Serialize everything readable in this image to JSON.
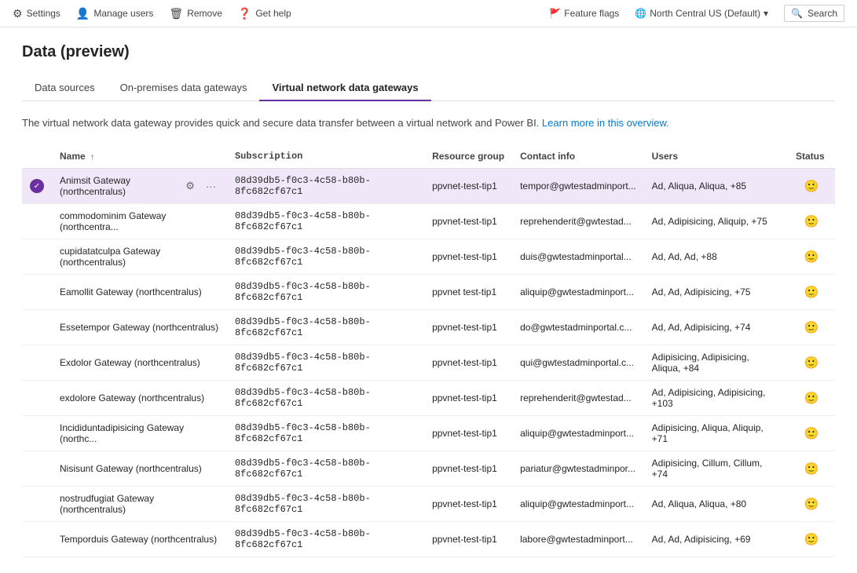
{
  "topbar": {
    "settings_label": "Settings",
    "manage_users_label": "Manage users",
    "remove_label": "Remove",
    "get_help_label": "Get help",
    "feature_flags_label": "Feature flags",
    "region_label": "North Central US (Default)",
    "search_label": "Search"
  },
  "page": {
    "title": "Data (preview)",
    "info_text": "The virtual network data gateway provides quick and secure data transfer between a virtual network and Power BI.",
    "info_link_text": "Learn more in this overview.",
    "tabs": [
      {
        "id": "data-sources",
        "label": "Data sources"
      },
      {
        "id": "on-premises",
        "label": "On-premises data gateways"
      },
      {
        "id": "virtual-network",
        "label": "Virtual network data gateways",
        "active": true
      }
    ],
    "table": {
      "columns": [
        {
          "id": "name",
          "label": "Name",
          "sort": "↑"
        },
        {
          "id": "subscription",
          "label": "Subscription"
        },
        {
          "id": "resource_group",
          "label": "Resource group"
        },
        {
          "id": "contact_info",
          "label": "Contact info"
        },
        {
          "id": "users",
          "label": "Users"
        },
        {
          "id": "status",
          "label": "Status"
        }
      ],
      "rows": [
        {
          "id": 1,
          "selected": true,
          "name": "Animsit Gateway (northcentralus)",
          "subscription": "08d39db5-f0c3-4c58-b80b-8fc682cf67c1",
          "resource_group": "ppvnet-test-tip1",
          "contact_info": "tempor@gwtestadminport...",
          "users": "Ad, Aliqua, Aliqua, +85",
          "status": "ok"
        },
        {
          "id": 2,
          "selected": false,
          "name": "commodominim Gateway (northcentra...",
          "subscription": "08d39db5-f0c3-4c58-b80b-8fc682cf67c1",
          "resource_group": "ppvnet-test-tip1",
          "contact_info": "reprehenderit@gwtestad...",
          "users": "Ad, Adipisicing, Aliquip, +75",
          "status": "ok"
        },
        {
          "id": 3,
          "selected": false,
          "name": "cupidatatculpa Gateway (northcentralus)",
          "subscription": "08d39db5-f0c3-4c58-b80b-8fc682cf67c1",
          "resource_group": "ppvnet-test-tip1",
          "contact_info": "duis@gwtestadminportal...",
          "users": "Ad, Ad, Ad, +88",
          "status": "ok"
        },
        {
          "id": 4,
          "selected": false,
          "name": "Eamollit Gateway (northcentralus)",
          "subscription": "08d39db5-f0c3-4c58-b80b-8fc682cf67c1",
          "resource_group": "ppvnet test-tip1",
          "contact_info": "aliquip@gwtestadminport...",
          "users": "Ad, Ad, Adipisicing, +75",
          "status": "ok"
        },
        {
          "id": 5,
          "selected": false,
          "name": "Essetempor Gateway (northcentralus)",
          "subscription": "08d39db5-f0c3-4c58-b80b-8fc682cf67c1",
          "resource_group": "ppvnet-test-tip1",
          "contact_info": "do@gwtestadminportal.c...",
          "users": "Ad, Ad, Adipisicing, +74",
          "status": "ok"
        },
        {
          "id": 6,
          "selected": false,
          "name": "Exdolor Gateway (northcentralus)",
          "subscription": "08d39db5-f0c3-4c58-b80b-8fc682cf67c1",
          "resource_group": "ppvnet-test-tip1",
          "contact_info": "qui@gwtestadminportal.c...",
          "users": "Adipisicing, Adipisicing, Aliqua, +84",
          "status": "ok"
        },
        {
          "id": 7,
          "selected": false,
          "name": "exdolore Gateway (northcentralus)",
          "subscription": "08d39db5-f0c3-4c58-b80b-8fc682cf67c1",
          "resource_group": "ppvnet-test-tip1",
          "contact_info": "reprehenderit@gwtestad...",
          "users": "Ad, Adipisicing, Adipisicing, +103",
          "status": "ok"
        },
        {
          "id": 8,
          "selected": false,
          "name": "Incididuntadipisicing Gateway (northc...",
          "subscription": "08d39db5-f0c3-4c58-b80b-8fc682cf67c1",
          "resource_group": "ppvnet-test-tip1",
          "contact_info": "aliquip@gwtestadminport...",
          "users": "Adipisicing, Aliqua, Aliquip, +71",
          "status": "ok"
        },
        {
          "id": 9,
          "selected": false,
          "name": "Nisisunt Gateway (northcentralus)",
          "subscription": "08d39db5-f0c3-4c58-b80b-8fc682cf67c1",
          "resource_group": "ppvnet-test-tip1",
          "contact_info": "pariatur@gwtestadminpor...",
          "users": "Adipisicing, Cillum, Cillum, +74",
          "status": "ok"
        },
        {
          "id": 10,
          "selected": false,
          "name": "nostrudfugiat Gateway (northcentralus)",
          "subscription": "08d39db5-f0c3-4c58-b80b-8fc682cf67c1",
          "resource_group": "ppvnet-test-tip1",
          "contact_info": "aliquip@gwtestadminport...",
          "users": "Ad, Aliqua, Aliqua, +80",
          "status": "ok"
        },
        {
          "id": 11,
          "selected": false,
          "name": "Temporduis Gateway (northcentralus)",
          "subscription": "08d39db5-f0c3-4c58-b80b-8fc682cf67c1",
          "resource_group": "ppvnet-test-tip1",
          "contact_info": "labore@gwtestadminport...",
          "users": "Ad, Ad, Adipisicing, +69",
          "status": "ok"
        }
      ]
    }
  }
}
